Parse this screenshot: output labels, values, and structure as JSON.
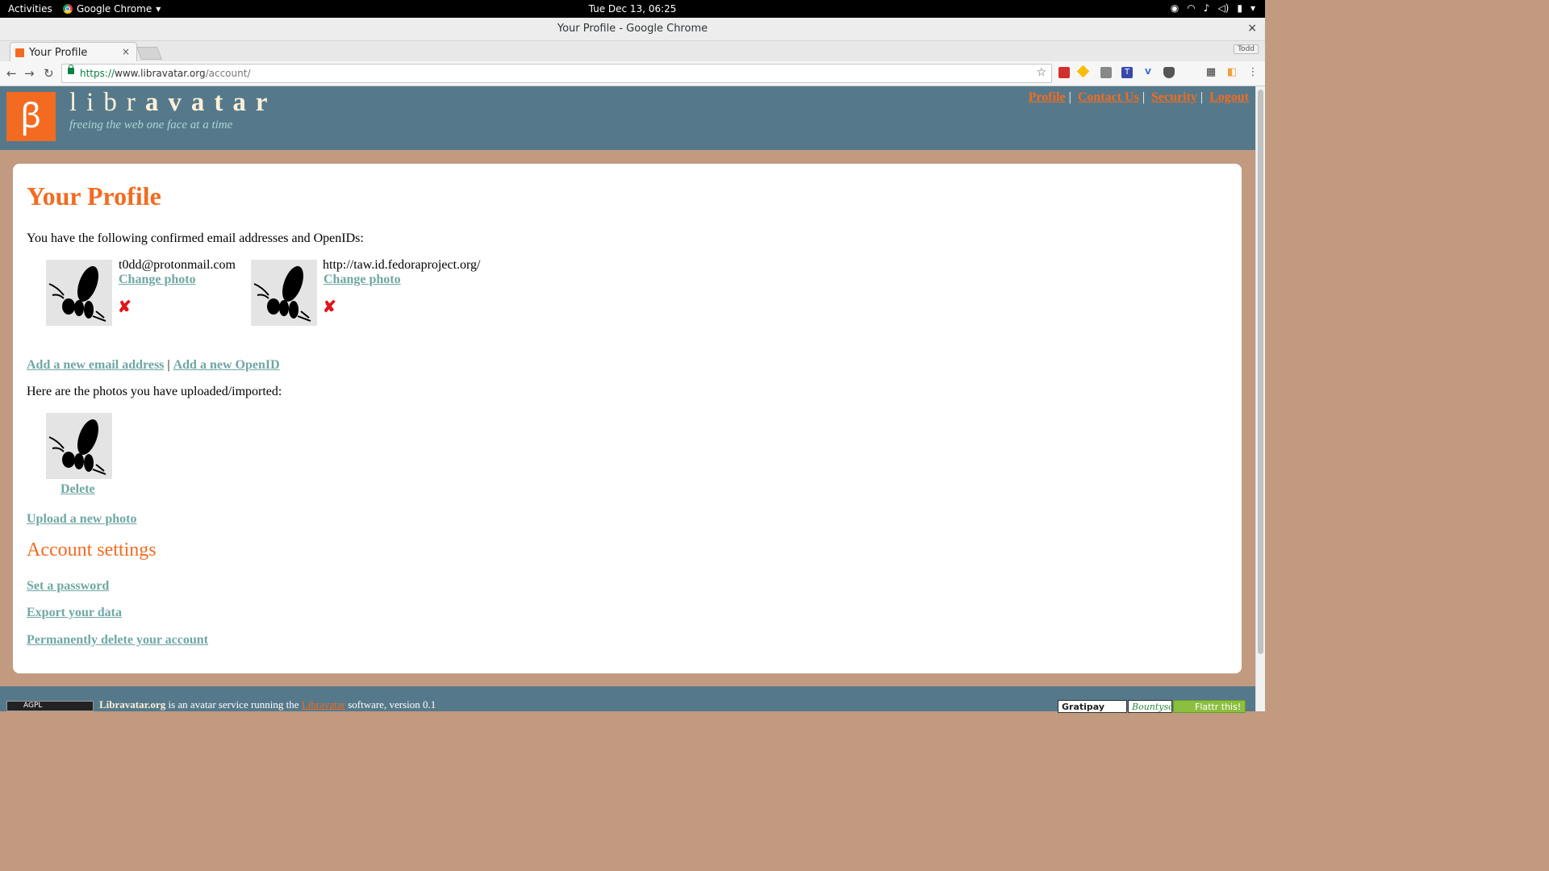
{
  "system_bar": {
    "activities": "Activities",
    "app_name": "Google Chrome",
    "clock": "Tue Dec 13, 06:25"
  },
  "window": {
    "title": "Your Profile - Google Chrome",
    "close_glyph": "×"
  },
  "tabs": [
    {
      "label": "Your Profile",
      "close_glyph": "×"
    }
  ],
  "profile_button": "Todd",
  "address_bar": {
    "scheme": "https://",
    "host": "www.libravatar.org",
    "path": "/account/"
  },
  "site": {
    "brand_light": "libr",
    "brand_bold": "avatar",
    "tagline": "freeing the web one face at a time",
    "nav": [
      "Profile",
      "Contact Us",
      "Security",
      "Logout"
    ]
  },
  "main": {
    "title": "Your Profile",
    "intro": "You have the following confirmed email addresses and OpenIDs:",
    "identities": [
      {
        "value": "t0dd@protonmail.com",
        "change_label": "Change photo",
        "delete_glyph": "✘"
      },
      {
        "value": "http://taw.id.fedoraproject.org/",
        "change_label": "Change photo",
        "delete_glyph": "✘"
      }
    ],
    "add_email": "Add a new email address",
    "separator": "|",
    "add_openid": "Add a new OpenID",
    "photos_intro": "Here are the photos you have uploaded/imported:",
    "photo_delete": "Delete",
    "upload_photo": "Upload a new photo",
    "account_settings_title": "Account settings",
    "settings_links": [
      "Set a password",
      "Export your data",
      "Permanently delete your account"
    ]
  },
  "footer": {
    "agpl": "AGPL",
    "site_name": "Libravatar.org",
    "text_mid": " is an avatar service running the ",
    "software_link": "Libravatar",
    "text_end": " software, version 0.1",
    "badges": [
      "Gratipay",
      "Bountysource",
      "Flattr this!"
    ]
  },
  "colors": {
    "accent_orange": "#f26b21",
    "header_teal": "#55798a",
    "link_teal": "#6fa7a3",
    "page_bg": "#c19a80"
  }
}
